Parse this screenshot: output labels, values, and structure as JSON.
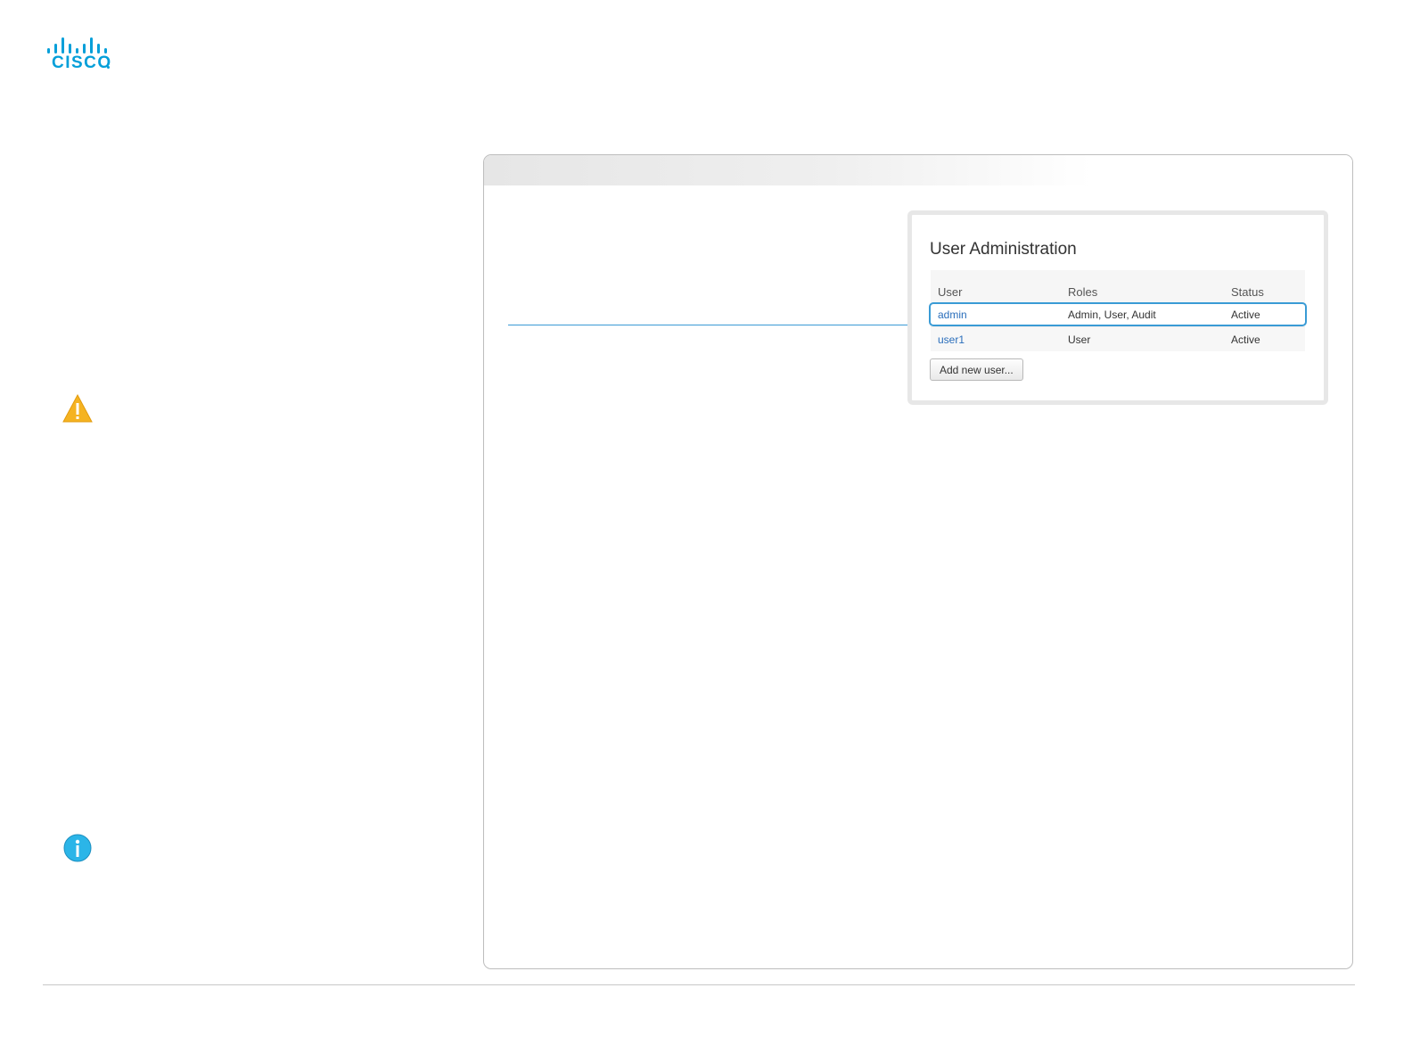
{
  "colors": {
    "brand": "#049fd9",
    "accent": "#3a9bd5",
    "warning": "#f5b321",
    "info": "#2bb5e8",
    "link": "#2a6ebb"
  },
  "logo": {
    "wordmark": "CISCO",
    "icon": "cisco-bridge-icon"
  },
  "icons": {
    "warning": "warning-triangle-icon",
    "info": "info-circle-icon"
  },
  "user_admin": {
    "title": "User Administration",
    "columns": [
      "User",
      "Roles",
      "Status"
    ],
    "rows": [
      {
        "user": "admin",
        "roles": "Admin, User, Audit",
        "status": "Active"
      },
      {
        "user": "user1",
        "roles": "User",
        "status": "Active"
      }
    ],
    "add_button_label": "Add new user..."
  }
}
